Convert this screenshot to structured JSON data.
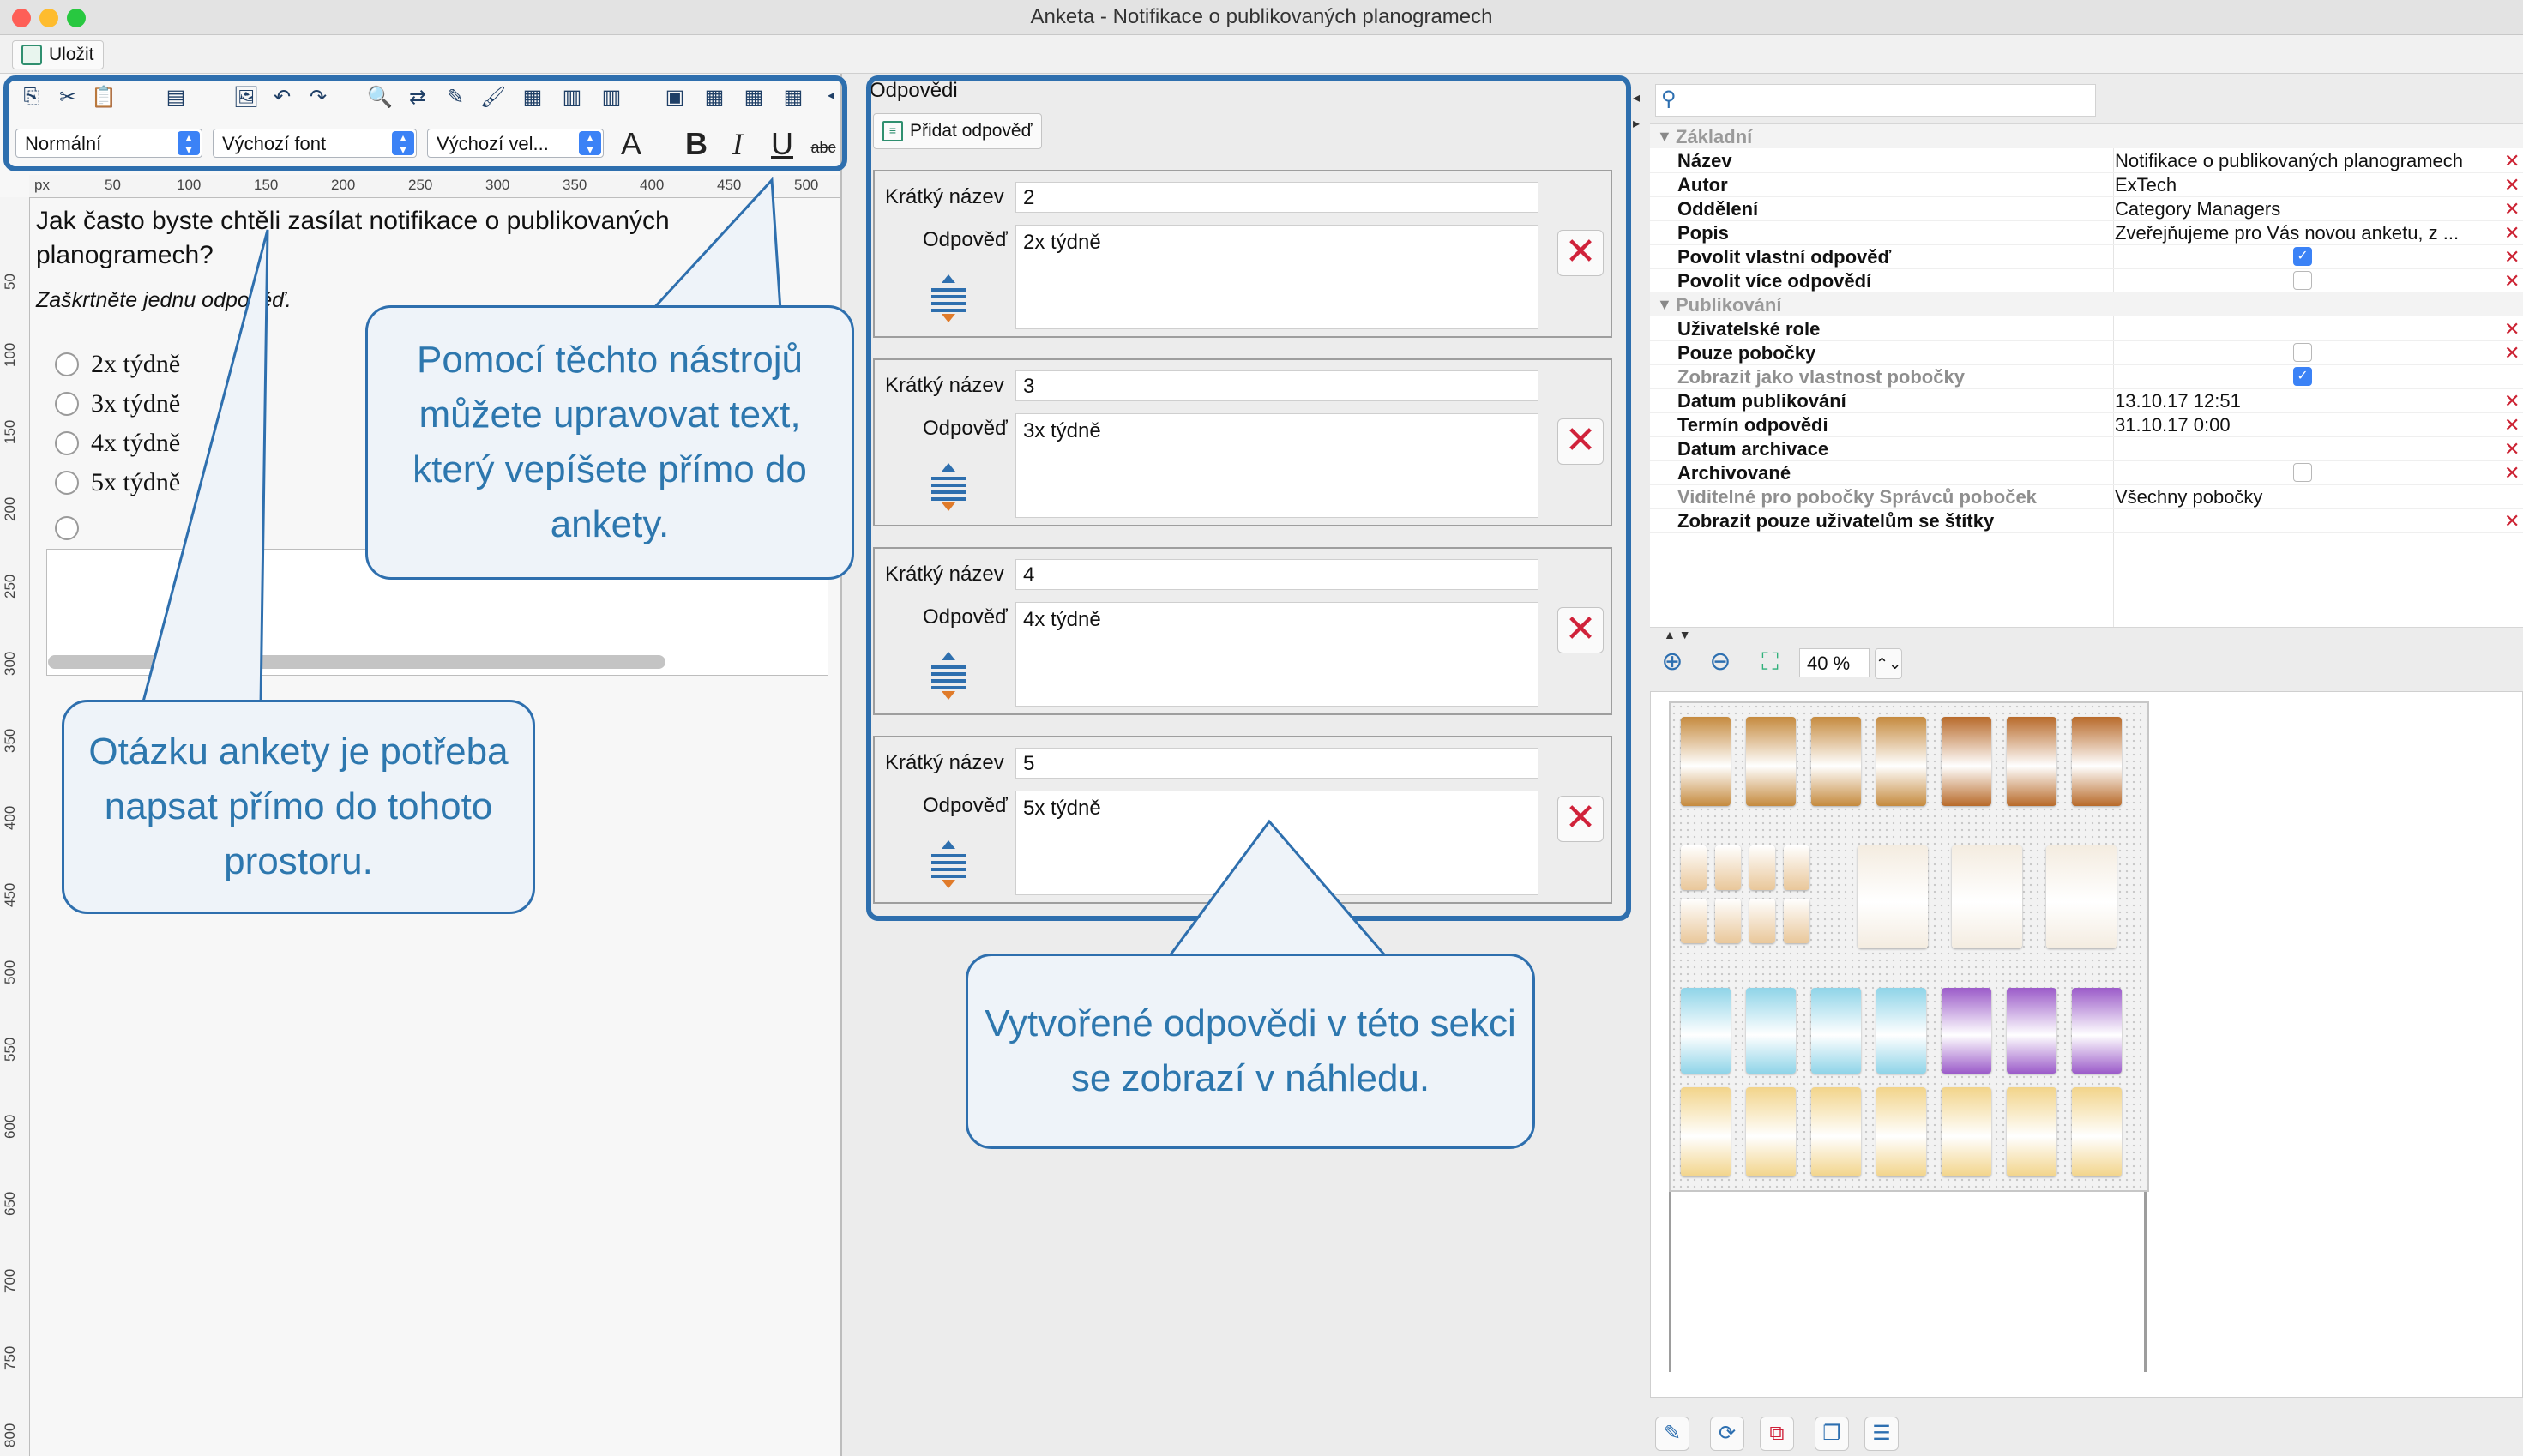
{
  "window": {
    "title": "Anketa - Notifikace o publikovaných planogramech"
  },
  "toolbar": {
    "save_label": "Uložit"
  },
  "editor": {
    "style_combo": "Normální",
    "font_combo": "Výchozí font",
    "size_combo": "Výchozí vel...",
    "ruler_unit": "px",
    "ruler_marks": [
      "50",
      "100",
      "150",
      "200",
      "250",
      "300",
      "350",
      "400",
      "450",
      "500"
    ],
    "vruler_marks": [
      "50",
      "100",
      "150",
      "200",
      "250",
      "300",
      "350",
      "400",
      "450",
      "500",
      "550",
      "600",
      "650",
      "700",
      "750",
      "800"
    ],
    "question": "Jak často byste chtěli zasílat notifikace o publikovaných planogramech?",
    "hint": "Zaškrtněte jednu odpověď.",
    "options": [
      "2x týdně",
      "3x týdně",
      "4x týdně",
      "5x týdně",
      ""
    ]
  },
  "callouts": {
    "toolbar_note": "Pomocí těchto nástrojů můžete upravovat text, který vepíšete přímo do ankety.",
    "question_note": "Otázku ankety je potřeba napsat přímo do tohoto prostoru.",
    "answers_note": "Vytvořené odpovědi v této sekci se zobrazí v náhledu."
  },
  "answers": {
    "title": "Odpovědi",
    "add_label": "Přidat odpověď",
    "short_name_label": "Krátký název",
    "answer_label": "Odpověď",
    "items": [
      {
        "short": "2",
        "text": "2x týdně"
      },
      {
        "short": "3",
        "text": "3x týdně"
      },
      {
        "short": "4",
        "text": "4x týdně"
      },
      {
        "short": "5",
        "text": "5x týdně"
      }
    ]
  },
  "properties": {
    "group_basic": "Základní",
    "group_publish": "Publikování",
    "rows": {
      "nazev": {
        "name": "Název",
        "value": "Notifikace o publikovaných planogramech"
      },
      "autor": {
        "name": "Autor",
        "value": "ExTech"
      },
      "oddeleni": {
        "name": "Oddělení",
        "value": "Category Managers"
      },
      "popis": {
        "name": "Popis",
        "value": "Zveřejňujeme pro Vás novou anketu, z ..."
      },
      "vlastni": {
        "name": "Povolit vlastní odpověď",
        "checked": true
      },
      "vice": {
        "name": "Povolit více odpovědí",
        "checked": false
      },
      "role": {
        "name": "Uživatelské role",
        "value": ""
      },
      "pobocky": {
        "name": "Pouze pobočky",
        "checked": false
      },
      "vlastnost": {
        "name": "Zobrazit jako vlastnost pobočky",
        "checked": true
      },
      "datum_pub": {
        "name": "Datum publikování",
        "value": "13.10.17 12:51"
      },
      "termin": {
        "name": "Termín odpovědi",
        "value": "31.10.17 0:00"
      },
      "archivace": {
        "name": "Datum archivace",
        "value": ""
      },
      "archivovane": {
        "name": "Archivované",
        "checked": false
      },
      "viditelne": {
        "name": "Viditelné pro pobočky Správců poboček",
        "value": "Všechny pobočky"
      },
      "stitky": {
        "name": "Zobrazit pouze uživatelům se štítky",
        "value": ""
      }
    }
  },
  "preview": {
    "zoom": "40 %"
  },
  "colors": {
    "accent": "#2e6fae",
    "callout_text": "#2d77ae",
    "delete": "#d0223a"
  }
}
